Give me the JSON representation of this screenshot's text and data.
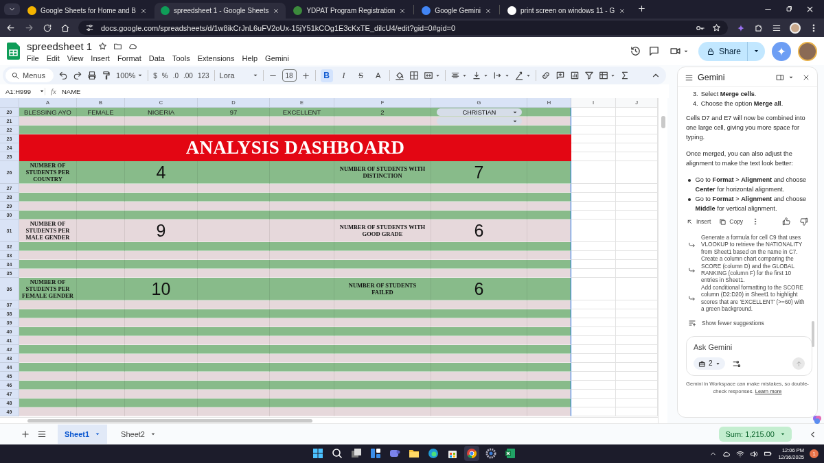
{
  "browser": {
    "tabs": [
      {
        "title": "Google Sheets for Home and B",
        "selected": false
      },
      {
        "title": "spreedsheet 1 - Google Sheets",
        "selected": true
      },
      {
        "title": "YDPAT Program Registration",
        "selected": false
      },
      {
        "title": "Google Gemini",
        "selected": false
      },
      {
        "title": "print screen on windows 11 - G",
        "selected": false
      }
    ],
    "url": "docs.google.com/spreadsheets/d/1w8ikCrJnL6uFV2oUx-15jY51kCOg1E3cKxTE_dilcU4/edit?gid=0#gid=0"
  },
  "document": {
    "title": "spreedsheet 1",
    "menu": [
      "File",
      "Edit",
      "View",
      "Insert",
      "Format",
      "Data",
      "Tools",
      "Extensions",
      "Help",
      "Gemini"
    ],
    "share_button": "Share"
  },
  "toolbar": {
    "search": "Menus",
    "zoom": "100%",
    "number_formats": [
      "$",
      "%",
      ".0",
      ".00",
      "123"
    ],
    "font": "Lora",
    "font_size": "18",
    "text_styles": [
      {
        "kind": "bold",
        "label": "B",
        "selected": true
      },
      {
        "kind": "italic",
        "label": "I",
        "selected": false
      },
      {
        "kind": "strikethrough",
        "label": "S",
        "selected": false
      },
      {
        "kind": "text-color",
        "label": "A",
        "selected": false
      }
    ]
  },
  "formula_bar": {
    "range": "A1:H999",
    "function_label": "fx",
    "content": "NAME"
  },
  "sheet": {
    "columns": [
      "A",
      "B",
      "C",
      "D",
      "E",
      "F",
      "G",
      "H",
      "I",
      "J"
    ],
    "rows": [
      {
        "number": "20",
        "kind": "data",
        "color": "#88bb8a",
        "cells": [
          "BLESSING AYO",
          "FEMALE",
          "NIGERIA",
          "97",
          "EXCELLENT",
          "2"
        ],
        "dropdown": "CHRISTIAN"
      },
      {
        "number": "21",
        "kind": "blank",
        "color": "#e6d8db",
        "dropdown": true
      },
      {
        "number": "22",
        "kind": "blank",
        "color": "#88bb8a"
      },
      {
        "numbers": [
          "23",
          "24",
          "25"
        ],
        "kind": "banner",
        "color": "#e30613",
        "title": "ANALYSIS DASHBOARD"
      },
      {
        "number": "26",
        "kind": "stat",
        "color": "#88bb8a",
        "stats": [
          {
            "label": "NUMBER OF STUDENTS PER COUNTRY",
            "value": "4"
          },
          {
            "label": "NUMBER OF STUDENTS WITH DISTINCTION",
            "value": "7"
          }
        ]
      },
      {
        "number": "27",
        "kind": "blank",
        "color": "#e6d8db"
      },
      {
        "number": "28",
        "kind": "blank",
        "color": "#88bb8a"
      },
      {
        "number": "29",
        "kind": "blank",
        "color": "#e6d8db"
      },
      {
        "number": "30",
        "kind": "blank",
        "color": "#88bb8a"
      },
      {
        "number": "31",
        "kind": "stat",
        "color": "#e6d8db",
        "stats": [
          {
            "label": "NUMBER OF STUDENTS PER MALE GENDER",
            "value": "9"
          },
          {
            "label": "NUMBER OF STUDENTS WITH GOOD GRADE",
            "value": "6"
          }
        ]
      },
      {
        "number": "32",
        "kind": "blank",
        "color": "#88bb8a"
      },
      {
        "number": "33",
        "kind": "blank",
        "color": "#e6d8db"
      },
      {
        "number": "34",
        "kind": "blank",
        "color": "#88bb8a"
      },
      {
        "number": "35",
        "kind": "blank",
        "color": "#e6d8db"
      },
      {
        "number": "36",
        "kind": "stat",
        "color": "#88bb8a",
        "stats": [
          {
            "label": "NUMBER OF STUDENTS PER FEMALE GENDER",
            "value": "10"
          },
          {
            "label": "NUMBER OF STUDENTS FAILED",
            "value": "6"
          }
        ]
      },
      {
        "number": "37",
        "kind": "blank",
        "color": "#e6d8db"
      },
      {
        "number": "38",
        "kind": "blank",
        "color": "#88bb8a"
      },
      {
        "number": "39",
        "kind": "blank",
        "color": "#e6d8db"
      },
      {
        "number": "40",
        "kind": "blank",
        "color": "#88bb8a"
      },
      {
        "number": "41",
        "kind": "blank",
        "color": "#e6d8db"
      },
      {
        "number": "42",
        "kind": "blank",
        "color": "#88bb8a"
      },
      {
        "number": "43",
        "kind": "blank",
        "color": "#e6d8db"
      },
      {
        "number": "44",
        "kind": "blank",
        "color": "#88bb8a"
      },
      {
        "number": "45",
        "kind": "blank",
        "color": "#e6d8db"
      },
      {
        "number": "46",
        "kind": "blank",
        "color": "#88bb8a"
      },
      {
        "number": "47",
        "kind": "blank",
        "color": "#e6d8db"
      },
      {
        "number": "48",
        "kind": "blank",
        "color": "#88bb8a"
      },
      {
        "number": "49",
        "kind": "blank",
        "color": "#e6d8db"
      }
    ]
  },
  "gemini": {
    "title": "Gemini",
    "steps": [
      {
        "number": "3.",
        "text": "Select **Merge cells**."
      },
      {
        "number": "4.",
        "text": "Choose the option **Merge all**."
      }
    ],
    "paragraphs": [
      "Cells D7 and E7 will now be combined into one large cell, giving you more space for typing.",
      "Once merged, you can also adjust the alignment to make the text look better:"
    ],
    "bullets": [
      "Go to **Format** > **Alignment** and choose **Center** for horizontal alignment.",
      "Go to **Format** > **Alignment** and choose **Middle** for vertical alignment."
    ],
    "actions": [
      "Insert",
      "Copy"
    ],
    "suggestions": [
      "Generate a formula for cell C9 that uses VLOOKUP to retrieve the NATIONALITY from Sheet1 based on the name in C7.",
      "Create a column chart comparing the SCORE (column D) and the GLOBAL RANKING (column F) for the first 10 entries in Sheet1.",
      "Add conditional formatting to the SCORE column (D2:D20) in Sheet1 to highlight scores that are 'EXCELLENT' (>=60) with a green background."
    ],
    "toggle_suggestions": "Show fewer suggestions",
    "input_placeholder": "Ask Gemini",
    "sources_count": "2",
    "disclaimer": "Gemini in Workspace can make mistakes, so double-check responses.",
    "disclaimer_link": "Learn more"
  },
  "sheet_tabs": {
    "tabs": [
      {
        "label": "Sheet1",
        "selected": true
      },
      {
        "label": "Sheet2",
        "selected": false
      }
    ],
    "summary": "Sum: 1,215.00"
  },
  "taskbar": {
    "time": "12:06 PM",
    "date": "12/16/2025",
    "notifications": "1"
  }
}
